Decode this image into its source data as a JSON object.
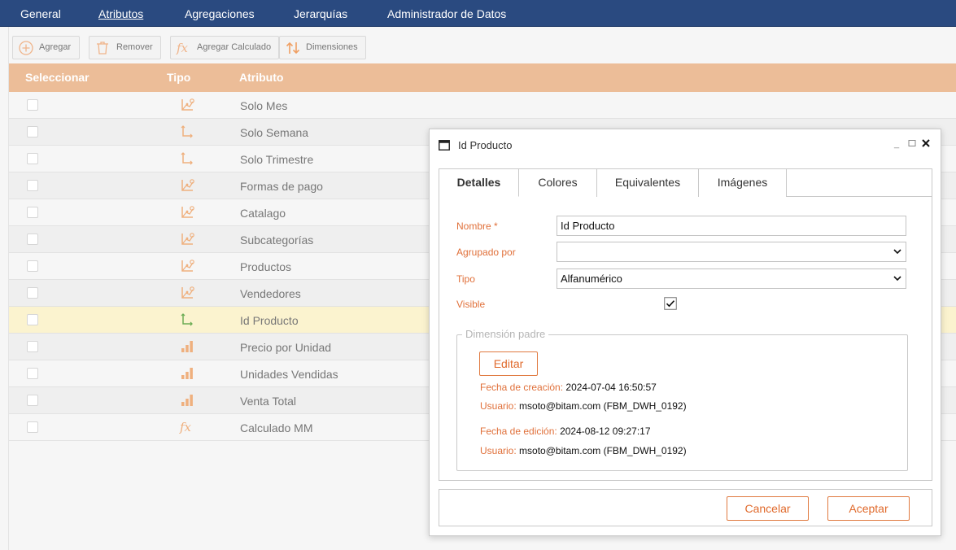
{
  "nav": {
    "items": [
      {
        "label": "General",
        "active": false
      },
      {
        "label": "Atributos",
        "active": true
      },
      {
        "label": "Agregaciones",
        "active": false
      },
      {
        "label": "Jerarquías",
        "active": false
      },
      {
        "label": "Administrador de Datos",
        "active": false
      }
    ]
  },
  "toolbar": {
    "add_label": "Agregar",
    "remove_label": "Remover",
    "add_calc_label": "Agregar Calculado",
    "dimensions_label": "Dimensiones"
  },
  "grid": {
    "columns": [
      "Seleccionar",
      "Tipo",
      "Atributo"
    ],
    "rows": [
      {
        "name": "Solo Mes",
        "icon": "hierarchy-dimension-icon"
      },
      {
        "name": "Solo Semana",
        "icon": "axis-dimension-icon"
      },
      {
        "name": "Solo Trimestre",
        "icon": "axis-dimension-icon"
      },
      {
        "name": "Formas de pago",
        "icon": "hierarchy-dimension-icon"
      },
      {
        "name": "Catalago",
        "icon": "hierarchy-dimension-icon"
      },
      {
        "name": "Subcategorías",
        "icon": "hierarchy-dimension-icon"
      },
      {
        "name": "Productos",
        "icon": "hierarchy-dimension-icon"
      },
      {
        "name": "Vendedores",
        "icon": "hierarchy-dimension-icon"
      },
      {
        "name": "Id Producto",
        "icon": "axis-dimension-icon"
      },
      {
        "name": "Precio por Unidad",
        "icon": "bar-measure-icon"
      },
      {
        "name": "Unidades Vendidas",
        "icon": "bar-measure-icon"
      },
      {
        "name": "Venta Total",
        "icon": "bar-measure-icon"
      },
      {
        "name": "Calculado MM",
        "icon": "fx-calculated-icon"
      }
    ],
    "selected_row": "Id Producto"
  },
  "modal": {
    "title": "Id Producto",
    "tabs": [
      "Detalles",
      "Colores",
      "Equivalentes",
      "Imágenes"
    ],
    "active_tab": "Detalles",
    "form": {
      "nombre_label": "Nombre",
      "required_mark": "*",
      "nombre_value": "Id Producto",
      "agrupado_label": "Agrupado por",
      "agrupado_value": "",
      "tipo_label": "Tipo",
      "tipo_value": "Alfanumérico",
      "visible_label": "Visible",
      "visible_checked": true
    },
    "parent": {
      "legend": "Dimensión padre",
      "edit_label": "Editar",
      "created_label": "Fecha de creación:",
      "created_value": "2024-07-04 16:50:57",
      "created_user_label": "Usuario:",
      "created_user_value": "msoto@bitam.com (FBM_DWH_0192)",
      "edited_label": "Fecha de edición:",
      "edited_value": "2024-08-12 09:27:17",
      "edited_user_label": "Usuario:",
      "edited_user_value": "msoto@bitam.com (FBM_DWH_0192)"
    },
    "cancel_label": "Cancelar",
    "accept_label": "Aceptar"
  },
  "colors": {
    "nav_bg": "#2a4a80",
    "grid_header_bg": "#ecbd98",
    "accent": "#e0703a",
    "icon_orange": "#efb07e",
    "icon_green": "#6cad55",
    "selected_row_bg": "#fbf3cf"
  }
}
